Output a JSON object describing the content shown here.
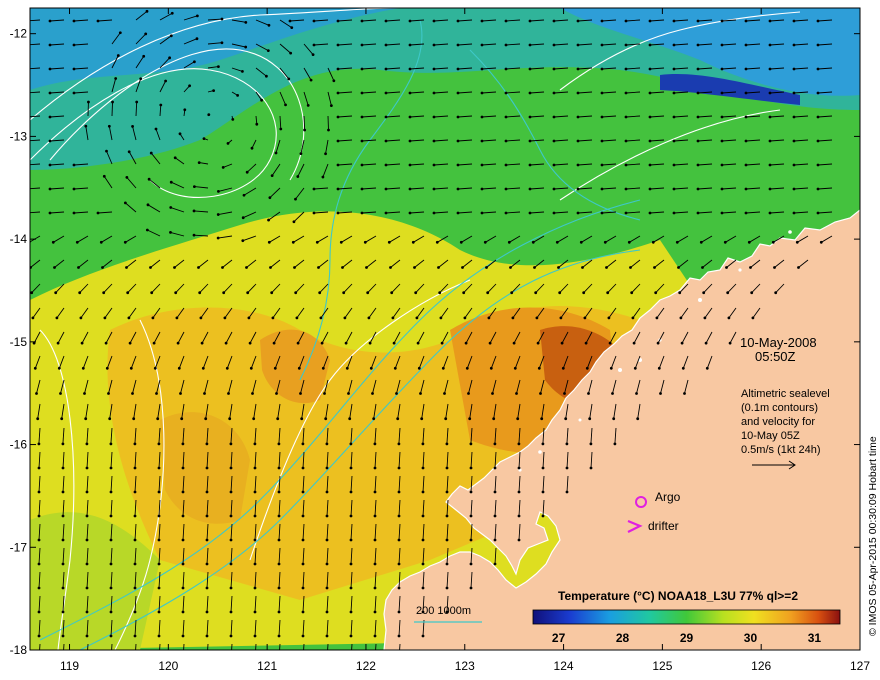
{
  "map": {
    "lon_ticks": [
      "119",
      "120",
      "121",
      "122",
      "123",
      "124",
      "125",
      "126",
      "127"
    ],
    "lat_ticks": [
      "-12",
      "-13",
      "-14",
      "-15",
      "-16",
      "-17",
      "-18"
    ],
    "lon_range": [
      118.6,
      127.0
    ],
    "lat_range": [
      -11.75,
      -18.0
    ],
    "colors": {
      "land": "#f8c8a2",
      "ocean_warm": "#e89a1c",
      "ocean_mid": "#dede20",
      "ocean_cool": "#44c23e",
      "ocean_cold": "#22a7c0",
      "contour_sea": "#ffffff",
      "isobath": "#3ec8c8",
      "argo": "#e020e0"
    }
  },
  "annotations": {
    "date": "10-May-2008",
    "time": "05:50Z",
    "altimetry_lines": [
      "Altimetric sealevel",
      "(0.1m contours)",
      "and velocity for",
      "10-May 05Z",
      "0.5m/s (1kt 24h)"
    ],
    "argo_label": "Argo",
    "drifter_label": "drifter",
    "isobath_label": "200  1000m"
  },
  "colorbar": {
    "title": "Temperature (°C) NOAA18_L3U 77% ql>=2",
    "tick_labels": [
      "27",
      "28",
      "29",
      "30",
      "31"
    ],
    "range": [
      26.6,
      31.4
    ]
  },
  "credit": "© IMOS 05-Apr-2015 00:30:09 Hobart time"
}
